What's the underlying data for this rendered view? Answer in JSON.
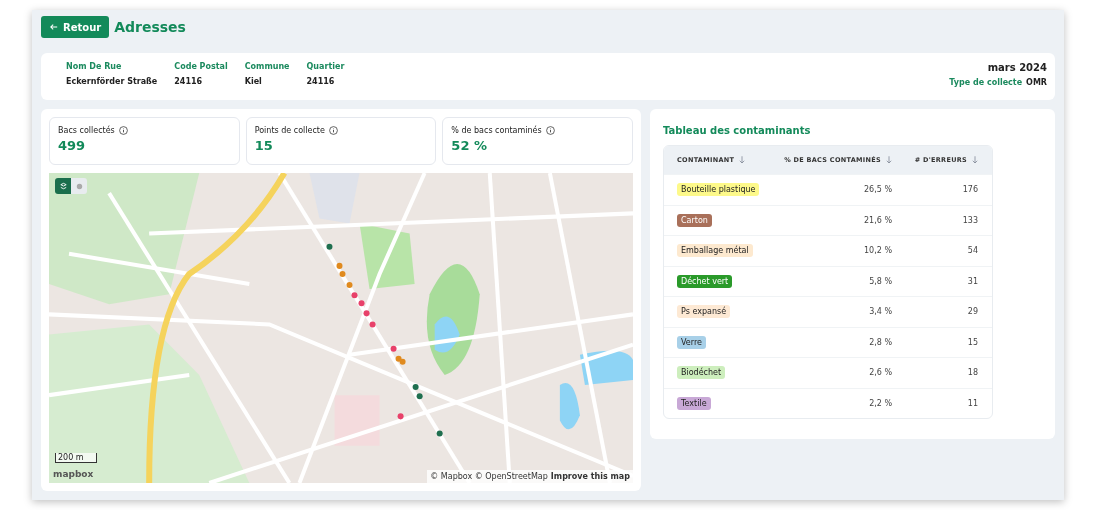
{
  "header": {
    "back_button": "Retour",
    "title": "Adresses"
  },
  "address": {
    "fields": [
      {
        "label": "Nom De Rue",
        "value": "Eckernförder Straße"
      },
      {
        "label": "Code Postal",
        "value": "24116"
      },
      {
        "label": "Commune",
        "value": "Kiel"
      },
      {
        "label": "Quartier",
        "value": "24116"
      }
    ],
    "period": "mars 2024",
    "collection_type_label": "Type de collecte",
    "collection_type": "OMR"
  },
  "stats": [
    {
      "label": "Bacs collectés",
      "value": "499"
    },
    {
      "label": "Points de collecte",
      "value": "15"
    },
    {
      "label": "% de bacs contaminés",
      "value": "52 %"
    }
  ],
  "map": {
    "scale": "200 m",
    "logo": "mapbox",
    "attribution": "© Mapbox © OpenStreetMap",
    "improve_link": "Improve this map"
  },
  "table": {
    "title": "Tableau des contaminants",
    "columns": [
      "CONTAMINANT",
      "% DE BACS CONTAMINÉS",
      "# D'ERREURS"
    ],
    "rows": [
      {
        "name": "Bouteille plastique",
        "color": "#fdf98a",
        "percent": "26,5 %",
        "errors": "176"
      },
      {
        "name": "Carton",
        "color": "#a9705a",
        "percent": "21,6 %",
        "errors": "133"
      },
      {
        "name": "Emballage métal",
        "color": "#fde9cf",
        "percent": "10,2 %",
        "errors": "54"
      },
      {
        "name": "Déchet vert",
        "color": "#2a9a2a",
        "percent": "5,8 %",
        "errors": "31"
      },
      {
        "name": "Ps expansé",
        "color": "#fde9d4",
        "percent": "3,4 %",
        "errors": "29"
      },
      {
        "name": "Verre",
        "color": "#a8d0e8",
        "percent": "2,8 %",
        "errors": "15"
      },
      {
        "name": "Biodéchet",
        "color": "#cdeebd",
        "percent": "2,6 %",
        "errors": "18"
      },
      {
        "name": "Textile",
        "color": "#c8a8d6",
        "percent": "2,2 %",
        "errors": "11"
      }
    ]
  }
}
